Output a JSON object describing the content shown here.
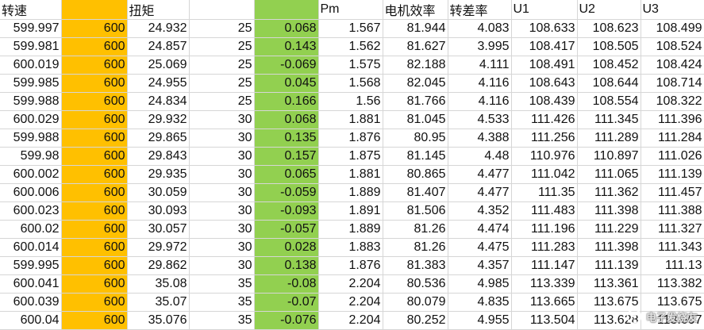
{
  "colors": {
    "column_b_fill": "#FFC000",
    "column_e_fill": "#92D050",
    "gridline": "#D6D6D6"
  },
  "sheet": {
    "header": [
      "转速",
      "",
      "扭矩",
      "",
      "",
      "Pm",
      "电机效率",
      "转差率",
      "U1",
      "U2",
      "U3"
    ],
    "rows": [
      [
        "599.997",
        "600",
        "24.932",
        "25",
        "0.068",
        "1.567",
        "81.944",
        "4.083",
        "108.633",
        "108.623",
        "108.499"
      ],
      [
        "599.981",
        "600",
        "24.857",
        "25",
        "0.143",
        "1.562",
        "81.627",
        "3.995",
        "108.417",
        "108.505",
        "108.524"
      ],
      [
        "600.019",
        "600",
        "25.069",
        "25",
        "-0.069",
        "1.575",
        "82.188",
        "4.111",
        "108.491",
        "108.452",
        "108.424"
      ],
      [
        "599.985",
        "600",
        "24.955",
        "25",
        "0.045",
        "1.568",
        "82.045",
        "4.116",
        "108.643",
        "108.644",
        "108.714"
      ],
      [
        "599.988",
        "600",
        "24.834",
        "25",
        "0.166",
        "1.56",
        "81.766",
        "4.116",
        "108.439",
        "108.554",
        "108.322"
      ],
      [
        "600.029",
        "600",
        "29.932",
        "30",
        "0.068",
        "1.881",
        "81.045",
        "4.533",
        "111.426",
        "111.345",
        "111.396"
      ],
      [
        "599.988",
        "600",
        "29.865",
        "30",
        "0.135",
        "1.876",
        "80.95",
        "4.388",
        "111.256",
        "111.289",
        "111.284"
      ],
      [
        "599.98",
        "600",
        "29.843",
        "30",
        "0.157",
        "1.875",
        "81.145",
        "4.48",
        "110.976",
        "110.897",
        "111.026"
      ],
      [
        "600.002",
        "600",
        "29.935",
        "30",
        "0.065",
        "1.881",
        "80.865",
        "4.477",
        "111.042",
        "111.065",
        "111.139"
      ],
      [
        "600.006",
        "600",
        "30.059",
        "30",
        "-0.059",
        "1.889",
        "81.407",
        "4.477",
        "111.35",
        "111.362",
        "111.457"
      ],
      [
        "600.023",
        "600",
        "30.093",
        "30",
        "-0.093",
        "1.891",
        "81.506",
        "4.352",
        "111.483",
        "111.398",
        "111.388"
      ],
      [
        "600.02",
        "600",
        "30.057",
        "30",
        "-0.057",
        "1.889",
        "81.26",
        "4.474",
        "111.196",
        "111.229",
        "111.327"
      ],
      [
        "600.014",
        "600",
        "29.972",
        "30",
        "0.028",
        "1.883",
        "81.26",
        "4.475",
        "111.283",
        "111.398",
        "111.343"
      ],
      [
        "599.995",
        "600",
        "29.862",
        "30",
        "0.138",
        "1.876",
        "81.383",
        "4.357",
        "111.147",
        "111.139",
        "111.13"
      ],
      [
        "600.041",
        "600",
        "35.08",
        "35",
        "-0.08",
        "2.204",
        "80.536",
        "4.985",
        "113.339",
        "113.361",
        "113.382"
      ],
      [
        "600.039",
        "600",
        "35.07",
        "35",
        "-0.07",
        "2.204",
        "80.079",
        "4.835",
        "113.665",
        "113.675",
        "113.675"
      ],
      [
        "600.04",
        "600",
        "35.076",
        "35",
        "-0.076",
        "2.204",
        "80.252",
        "4.955",
        "113.504",
        "113.628",
        "113.607"
      ]
    ]
  },
  "watermark": {
    "logo_icon": "elecfans-logo-icon",
    "text": "电子发烧友"
  }
}
